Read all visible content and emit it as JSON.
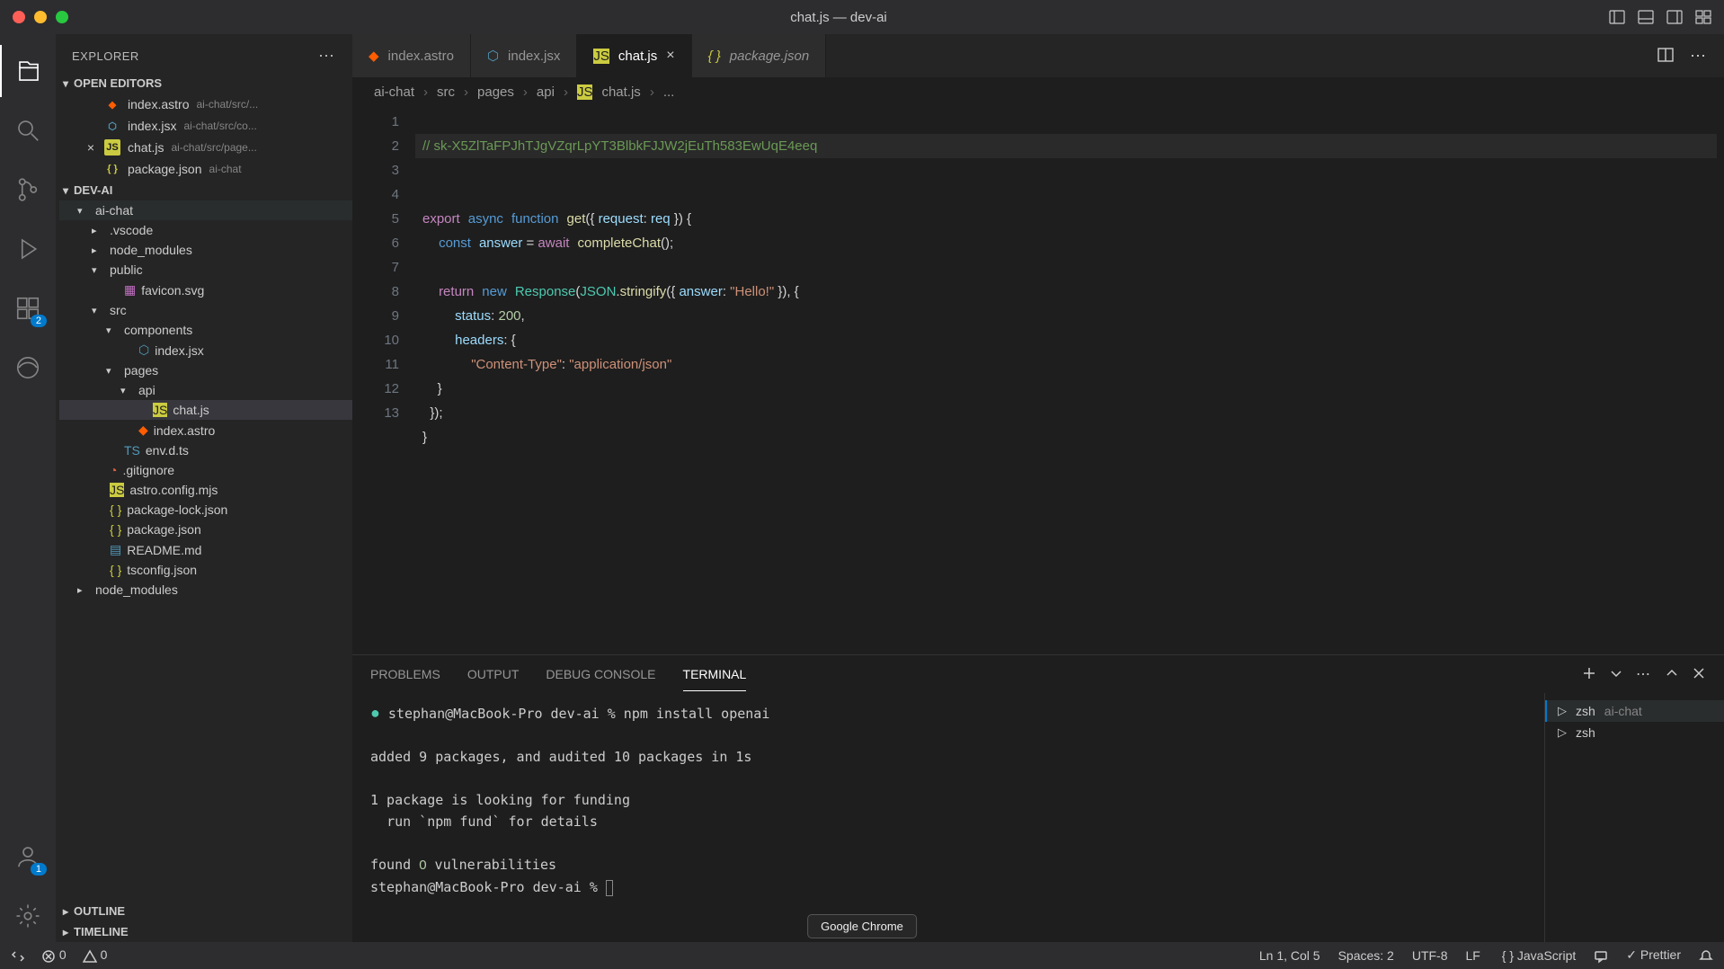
{
  "titlebar": {
    "title": "chat.js — dev-ai"
  },
  "sidebar": {
    "title": "EXPLORER",
    "sections": {
      "open_editors": "OPEN EDITORS",
      "project": "DEV-AI",
      "outline": "OUTLINE",
      "timeline": "TIMELINE"
    },
    "open_editors_items": [
      {
        "name": "index.astro",
        "path": "ai-chat/src/...",
        "icon": "astro"
      },
      {
        "name": "index.jsx",
        "path": "ai-chat/src/co...",
        "icon": "jsx"
      },
      {
        "name": "chat.js",
        "path": "ai-chat/src/page...",
        "icon": "js",
        "closeable": true
      },
      {
        "name": "package.json",
        "path": "ai-chat",
        "icon": "json"
      }
    ],
    "tree": [
      {
        "depth": 0,
        "chev": "▾",
        "name": "ai-chat",
        "kind": "folder",
        "highlight": true
      },
      {
        "depth": 1,
        "chev": "▸",
        "name": ".vscode",
        "kind": "folder"
      },
      {
        "depth": 1,
        "chev": "▸",
        "name": "node_modules",
        "kind": "folder"
      },
      {
        "depth": 1,
        "chev": "▾",
        "name": "public",
        "kind": "folder"
      },
      {
        "depth": 2,
        "chev": "",
        "name": "favicon.svg",
        "kind": "file",
        "icon": "svg-i"
      },
      {
        "depth": 1,
        "chev": "▾",
        "name": "src",
        "kind": "folder"
      },
      {
        "depth": 2,
        "chev": "▾",
        "name": "components",
        "kind": "folder"
      },
      {
        "depth": 3,
        "chev": "",
        "name": "index.jsx",
        "kind": "file",
        "icon": "jsx"
      },
      {
        "depth": 2,
        "chev": "▾",
        "name": "pages",
        "kind": "folder"
      },
      {
        "depth": 3,
        "chev": "▾",
        "name": "api",
        "kind": "folder"
      },
      {
        "depth": 4,
        "chev": "",
        "name": "chat.js",
        "kind": "file",
        "icon": "js",
        "active": true
      },
      {
        "depth": 3,
        "chev": "",
        "name": "index.astro",
        "kind": "file",
        "icon": "astro"
      },
      {
        "depth": 2,
        "chev": "",
        "name": "env.d.ts",
        "kind": "file",
        "icon": "ts"
      },
      {
        "depth": 1,
        "chev": "",
        "name": ".gitignore",
        "kind": "file",
        "icon": "git"
      },
      {
        "depth": 1,
        "chev": "",
        "name": "astro.config.mjs",
        "kind": "file",
        "icon": "js"
      },
      {
        "depth": 1,
        "chev": "",
        "name": "package-lock.json",
        "kind": "file",
        "icon": "json"
      },
      {
        "depth": 1,
        "chev": "",
        "name": "package.json",
        "kind": "file",
        "icon": "json"
      },
      {
        "depth": 1,
        "chev": "",
        "name": "README.md",
        "kind": "file",
        "icon": "md"
      },
      {
        "depth": 1,
        "chev": "",
        "name": "tsconfig.json",
        "kind": "file",
        "icon": "json"
      },
      {
        "depth": 0,
        "chev": "▸",
        "name": "node_modules",
        "kind": "folder"
      }
    ]
  },
  "tabs": [
    {
      "name": "index.astro",
      "icon": "astro"
    },
    {
      "name": "index.jsx",
      "icon": "jsx"
    },
    {
      "name": "chat.js",
      "icon": "js",
      "active": true,
      "close": true
    },
    {
      "name": "package.json",
      "icon": "json",
      "italic": true
    }
  ],
  "breadcrumb": [
    "ai-chat",
    "src",
    "pages",
    "api",
    "chat.js",
    "..."
  ],
  "code": {
    "lines": 13,
    "l1_comment": "// 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",
    "l3": {
      "export": "export",
      "async": "async",
      "function": "function",
      "name": "get",
      "open": "({ ",
      "param": "request",
      "colon": ": ",
      "alias": "req",
      "close": " }) {"
    },
    "l4": {
      "const": "const",
      "var": "answer",
      "eq": " = ",
      "await": "await",
      "fn": "completeChat",
      "end": "();"
    },
    "l6": {
      "return": "return",
      "new": "new",
      "Response": "Response",
      "open": "(",
      "JSON": "JSON",
      "dot": ".",
      "stringify": "stringify",
      "args": "({ ",
      "key": "answer",
      "colon": ": ",
      "str": "\"Hello!\"",
      "close": " }), {"
    },
    "l7": {
      "key": "status",
      "colon": ": ",
      "val": "200",
      "comma": ","
    },
    "l8": {
      "key": "headers",
      "colon": ": {"
    },
    "l9": {
      "key": "\"Content-Type\"",
      "colon": ": ",
      "val": "\"application/json\""
    },
    "l10": "    }",
    "l11": "  });",
    "l12": "}"
  },
  "panel": {
    "tabs": [
      "PROBLEMS",
      "OUTPUT",
      "DEBUG CONSOLE",
      "TERMINAL"
    ],
    "active_tab": "TERMINAL",
    "terminal": {
      "lines": [
        "stephan@MacBook-Pro dev-ai % npm install openai",
        "",
        "added 9 packages, and audited 10 packages in 1s",
        "",
        "1 package is looking for funding",
        "  run `npm fund` for details",
        "",
        "found 0 vulnerabilities",
        "stephan@MacBook-Pro dev-ai % "
      ]
    },
    "terminal_list": [
      {
        "name": "zsh",
        "sub": "ai-chat",
        "active": true
      },
      {
        "name": "zsh"
      }
    ]
  },
  "statusbar": {
    "errors": "0",
    "warnings": "0",
    "cursor": "Ln 1, Col 5",
    "spaces": "Spaces: 2",
    "encoding": "UTF-8",
    "eol": "LF",
    "lang": "JavaScript",
    "prettier": "Prettier"
  },
  "dock_hint": "Google Chrome",
  "activity_badge_ext": "2",
  "activity_badge_acc": "1"
}
